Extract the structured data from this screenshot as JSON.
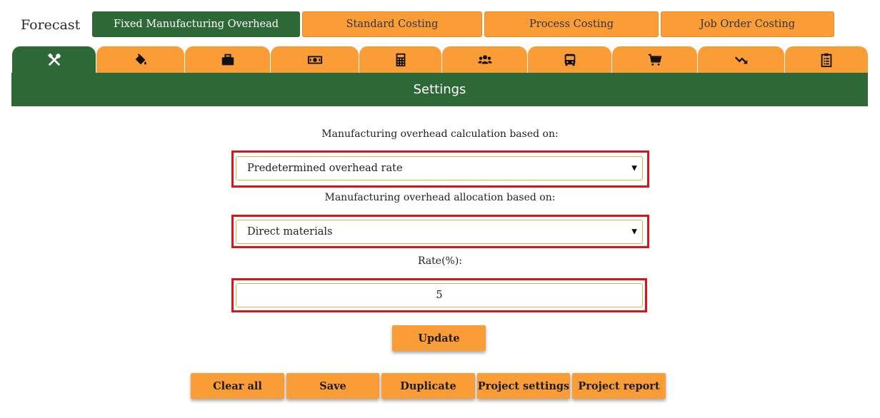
{
  "brand": "Forecast",
  "top_tabs": [
    {
      "label": "Fixed Manufacturing Overhead",
      "active": true
    },
    {
      "label": "Standard Costing",
      "active": false
    },
    {
      "label": "Process Costing",
      "active": false
    },
    {
      "label": "Job Order Costing",
      "active": false
    }
  ],
  "icon_tabs": [
    {
      "icon": "tools-icon",
      "active": true
    },
    {
      "icon": "paint-bucket-icon",
      "active": false
    },
    {
      "icon": "briefcase-icon",
      "active": false
    },
    {
      "icon": "money-bill-icon",
      "active": false
    },
    {
      "icon": "calculator-icon",
      "active": false
    },
    {
      "icon": "users-icon",
      "active": false
    },
    {
      "icon": "bus-icon",
      "active": false
    },
    {
      "icon": "shopping-cart-icon",
      "active": false
    },
    {
      "icon": "trend-down-icon",
      "active": false
    },
    {
      "icon": "clipboard-list-icon",
      "active": false
    }
  ],
  "section_title": "Settings",
  "form": {
    "calc_label": "Manufacturing overhead calculation based on:",
    "calc_value": "Predetermined overhead rate",
    "alloc_label": "Manufacturing overhead allocation based on:",
    "alloc_value": "Direct materials",
    "rate_label": "Rate(%):",
    "rate_value": "5",
    "update_label": "Update"
  },
  "footer_buttons": {
    "clear_all": "Clear all",
    "save": "Save",
    "duplicate": "Duplicate",
    "project_settings": "Project settings",
    "project_report": "Project report"
  },
  "colors": {
    "orange": "#fb9d36",
    "green": "#2c6937",
    "highlight": "#d8141d"
  }
}
